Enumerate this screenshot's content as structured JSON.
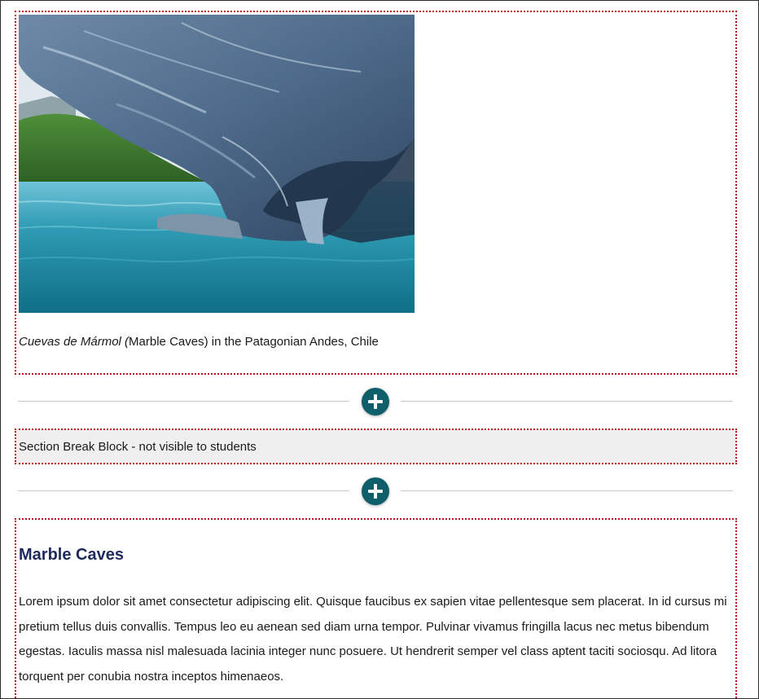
{
  "image_block": {
    "image_alt": "Marble caves over turquoise water",
    "caption_italic": "Cuevas de Mármol (",
    "caption_rest": "Marble Caves) in the Patagonian Andes, Chile"
  },
  "add_buttons": [
    {
      "icon": "plus-icon"
    },
    {
      "icon": "plus-icon"
    }
  ],
  "section_break": {
    "label": "Section Break Block - not visible to students"
  },
  "text_block": {
    "heading": "Marble Caves",
    "body": "Lorem ipsum dolor sit amet consectetur adipiscing elit. Quisque faucibus ex sapien vitae pellentesque sem placerat. In id cursus mi pretium tellus duis convallis. Tempus leo eu aenean sed diam urna tempor. Pulvinar vivamus fringilla lacus nec metus bibendum egestas. Iaculis massa nisl malesuada lacinia integer nunc posuere. Ut hendrerit semper vel class aptent taciti sociosqu. Ad litora torquent per conubia nostra inceptos himenaeos."
  },
  "colors": {
    "block_border": "#c0141c",
    "add_button": "#0f5f6a",
    "heading": "#1f2a5c",
    "section_break_bg": "#efefef"
  }
}
